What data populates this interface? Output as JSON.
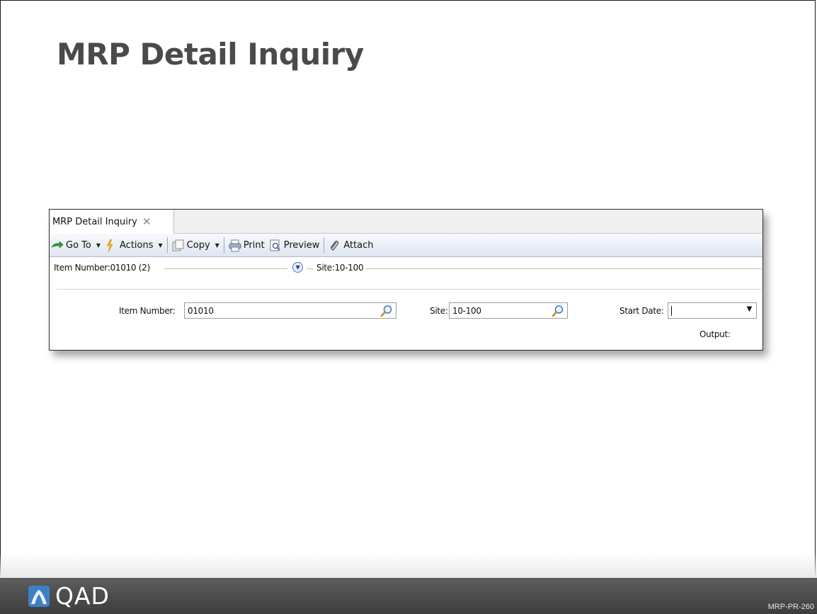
{
  "slide": {
    "title": "MRP Detail Inquiry",
    "footer_code": "MRP-PR-260",
    "brand": "QAD"
  },
  "window": {
    "tab_label": "MRP Detail Inquiry",
    "tab_close": "✕"
  },
  "toolbar": {
    "go_to": "Go To",
    "actions": "Actions",
    "copy": "Copy",
    "print": "Print",
    "preview": "Preview",
    "attach": "Attach"
  },
  "summary": {
    "item": "Item Number:01010 (2)",
    "site": "Site:10-100"
  },
  "form": {
    "item_number_label": "Item Number:",
    "item_number_value": "01010",
    "site_label": "Site:",
    "site_value": "10-100",
    "start_date_label": "Start Date:",
    "start_date_value": "",
    "output_label": "Output:"
  },
  "colors": {
    "title_text": "#4a4a4a",
    "toolbar_gradient_top": "#f7f9fc",
    "toolbar_gradient_bottom": "#dfe6f1",
    "footer_bar": "#4b4b4b",
    "logo_blue": "#3f7fc7"
  },
  "icons": {
    "go_to": "green-arrow-icon",
    "actions": "lightning-icon",
    "copy": "copy-icon",
    "print": "printer-icon",
    "preview": "preview-icon",
    "attach": "paperclip-icon",
    "lookup": "magnifier-icon",
    "expand": "chevron-down-circle-icon"
  }
}
